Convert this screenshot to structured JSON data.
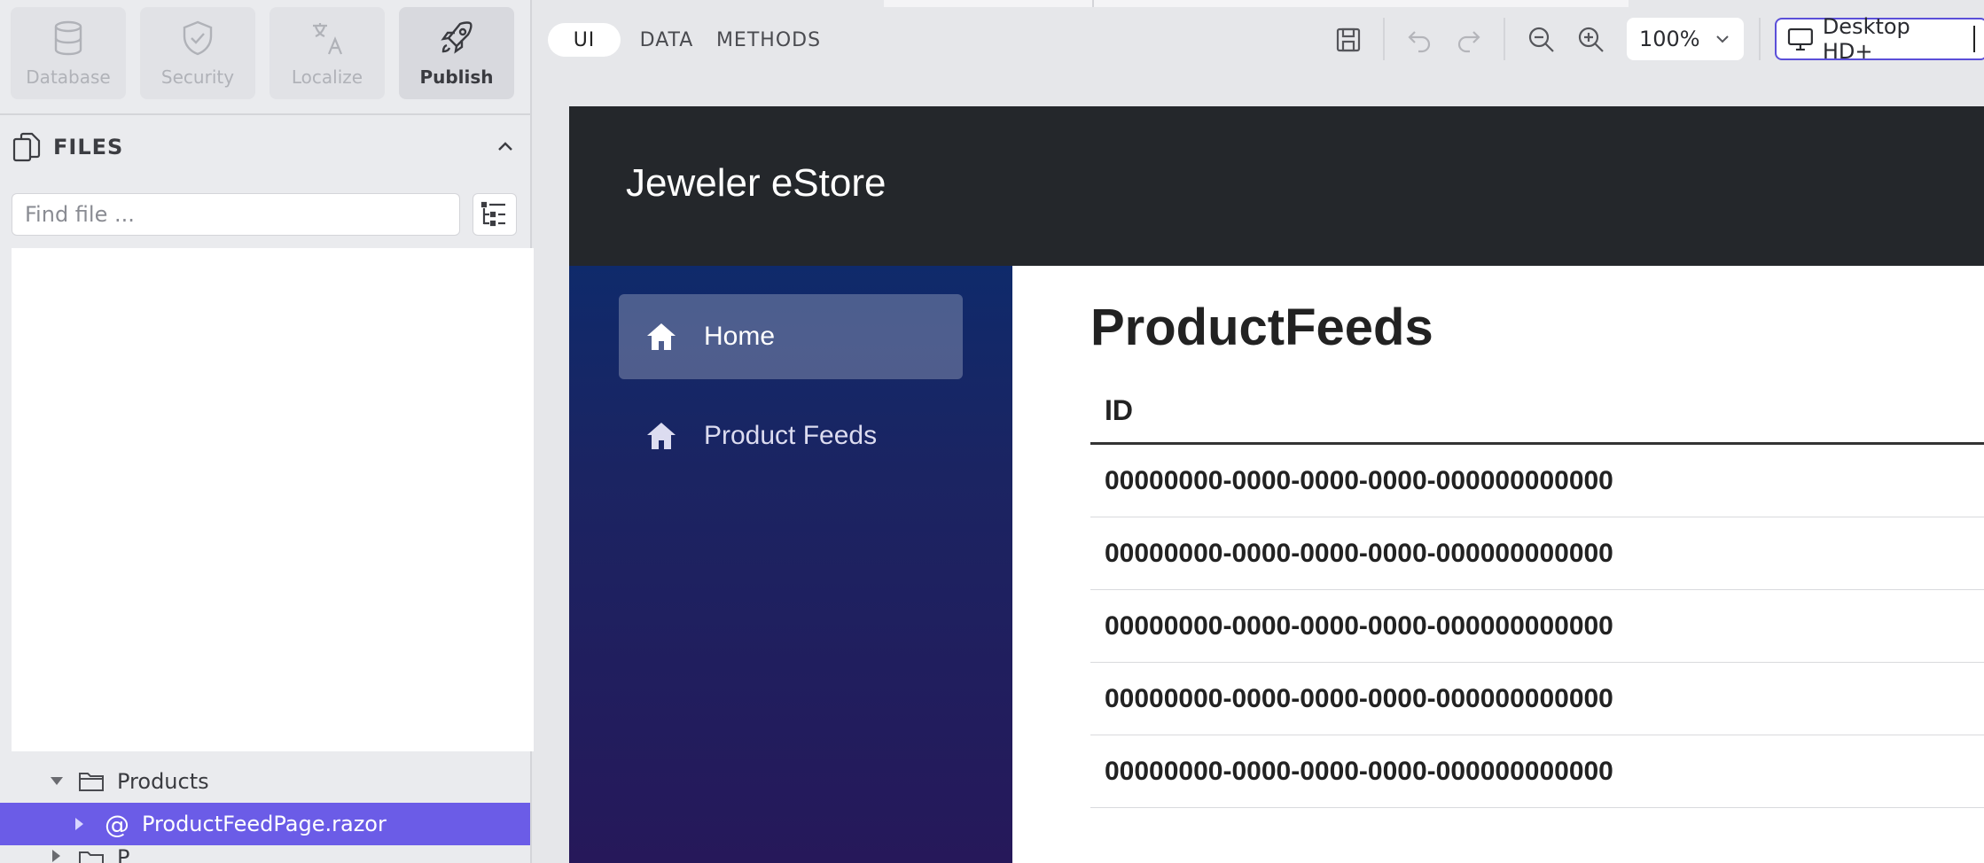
{
  "left_panel": {
    "tools": [
      {
        "label": "Database",
        "icon": "database-icon",
        "active": false
      },
      {
        "label": "Security",
        "icon": "shield-icon",
        "active": false
      },
      {
        "label": "Localize",
        "icon": "translate-icon",
        "active": false
      },
      {
        "label": "Publish",
        "icon": "rocket-icon",
        "active": true
      }
    ],
    "files": {
      "title": "FILES",
      "search_placeholder": "Find file ...",
      "search_value": ""
    },
    "tree": {
      "products_folder": "Products",
      "selected_file": "ProductFeedPage.razor",
      "next_folder_partial": "P"
    }
  },
  "toolbar": {
    "tabs": [
      {
        "label": "UI",
        "active": true
      },
      {
        "label": "DATA",
        "active": false
      },
      {
        "label": "METHODS",
        "active": false
      }
    ],
    "zoom": "100%",
    "device": "Desktop HD+"
  },
  "preview": {
    "app_title": "Jeweler eStore",
    "nav": [
      {
        "label": "Home",
        "icon": "home-icon",
        "active": true
      },
      {
        "label": "Product Feeds",
        "icon": "home-icon",
        "active": false
      }
    ],
    "page_title": "ProductFeeds",
    "table": {
      "header": "ID",
      "rows": [
        "00000000-0000-0000-0000-000000000000",
        "00000000-0000-0000-0000-000000000000",
        "00000000-0000-0000-0000-000000000000",
        "00000000-0000-0000-0000-000000000000",
        "00000000-0000-0000-0000-000000000000"
      ]
    }
  },
  "colors": {
    "accent": "#6b5ce7",
    "header_bg": "#24272b",
    "sidebar_top": "#0f2a6b",
    "sidebar_bottom": "#26185a"
  }
}
